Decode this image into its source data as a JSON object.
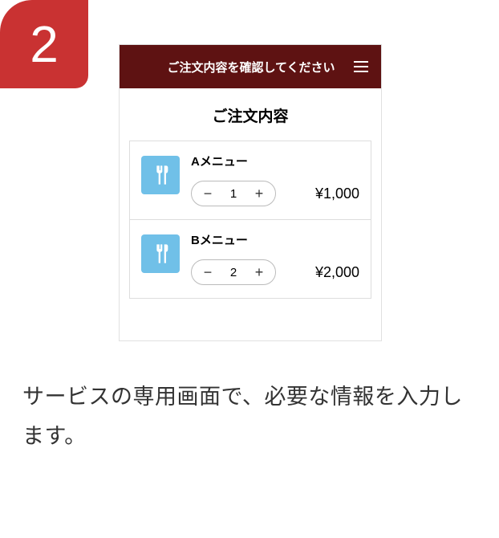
{
  "step": {
    "number": "2"
  },
  "app": {
    "header_title": "ご注文内容を確認してください",
    "section_title": "ご注文内容"
  },
  "items": [
    {
      "name": "Aメニュー",
      "qty": "1",
      "price": "¥1,000"
    },
    {
      "name": "Bメニュー",
      "qty": "2",
      "price": "¥2,000"
    }
  ],
  "stepper": {
    "minus": "−",
    "plus": "+"
  },
  "description": "サービスの専用画面で、必要な情報を入力します。"
}
